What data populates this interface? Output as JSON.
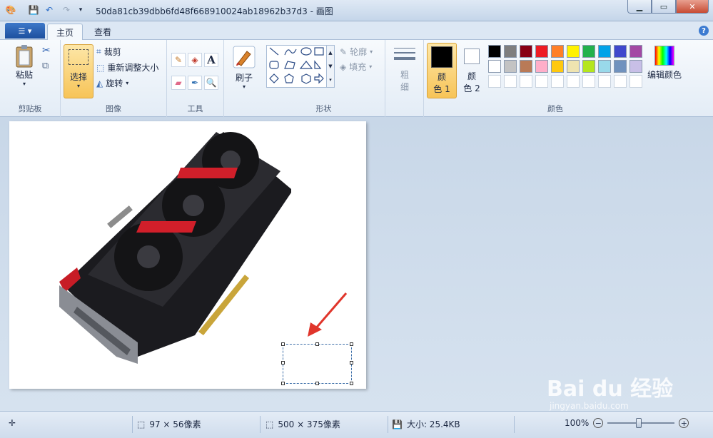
{
  "titlebar": {
    "title": "50da81cb39dbb6fd48f668910024ab18962b37d3 - 画图"
  },
  "tabs": {
    "home": "主页",
    "view": "查看"
  },
  "ribbon": {
    "clipboard": {
      "paste": "粘贴",
      "group": "剪贴板"
    },
    "image": {
      "select": "选择",
      "crop": "裁剪",
      "resize": "重新调整大小",
      "rotate": "旋转",
      "group": "图像"
    },
    "tools": {
      "group": "工具"
    },
    "brushes": {
      "label": "刷子"
    },
    "shapes": {
      "outline": "轮廓",
      "fill": "填充",
      "group": "形状"
    },
    "size": {
      "label_1": "粗",
      "label_2": "细"
    },
    "colors": {
      "color1_a": "颜",
      "color1_b": "色 1",
      "color2_a": "颜",
      "color2_b": "色 2",
      "edit": "编辑颜色",
      "group": "颜色",
      "color1": "#000000",
      "color2": "#ffffff",
      "palette_row1": [
        "#000000",
        "#7f7f7f",
        "#880015",
        "#ed1c24",
        "#ff7f27",
        "#fff200",
        "#22b14c",
        "#00a2e8",
        "#3f48cc",
        "#a349a4"
      ],
      "palette_row2": [
        "#ffffff",
        "#c3c3c3",
        "#b97a57",
        "#ffaec9",
        "#ffc90e",
        "#efe4b0",
        "#b5e61d",
        "#99d9ea",
        "#7092be",
        "#c8bfe7"
      ],
      "palette_row3": [
        "#ffffff",
        "#ffffff",
        "#ffffff",
        "#ffffff",
        "#ffffff",
        "#ffffff",
        "#ffffff",
        "#ffffff",
        "#ffffff",
        "#ffffff"
      ]
    }
  },
  "status": {
    "selection_size": "97 × 56像素",
    "image_size": "500 × 375像素",
    "file_size": "大小: 25.4KB",
    "zoom": "100%"
  },
  "watermark": {
    "brand": "Bai du 经验",
    "url": "jingyan.baidu.com"
  }
}
